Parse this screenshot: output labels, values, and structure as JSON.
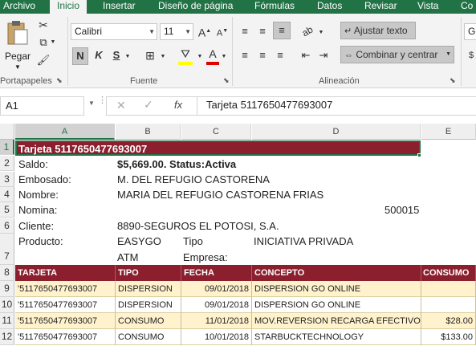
{
  "ribbon_tabs": [
    "Archivo",
    "Inicio",
    "Insertar",
    "Diseño de página",
    "Fórmulas",
    "Datos",
    "Revisar",
    "Vista",
    "Co"
  ],
  "clipboard": {
    "paste_label": "Pegar",
    "group_label": "Portapapeles"
  },
  "font": {
    "name": "Calibri",
    "size": "11",
    "bold": "N",
    "italic": "K",
    "underline": "S",
    "grow": "A",
    "shrink": "A",
    "color_a": "A",
    "group_label": "Fuente"
  },
  "alignment": {
    "wrap_text": "Ajustar texto",
    "merge_center": "Combinar y centrar",
    "group_label": "Alineación"
  },
  "number": {
    "format_partial": "Ge"
  },
  "formula_bar": {
    "cell_ref": "A1",
    "fx": "fx",
    "formula": "Tarjeta 5117650477693007"
  },
  "columns": [
    "A",
    "B",
    "C",
    "D",
    "E"
  ],
  "rows": [
    "1",
    "2",
    "3",
    "4",
    "5",
    "6",
    "7",
    "8",
    "9",
    "10",
    "11",
    "12"
  ],
  "sheet": {
    "title": "Tarjeta 5117650477693007",
    "saldo_label": "Saldo:",
    "saldo_value": "$5,669.00. Status:Activa",
    "embosado_label": "Embosado:",
    "embosado_value": "M. DEL REFUGIO CASTORENA",
    "nombre_label": "Nombre:",
    "nombre_value": "MARIA DEL REFUGIO CASTORENA FRIAS",
    "nomina_label": "Nomina:",
    "nomina_value": "500015",
    "cliente_label": "Cliente:",
    "cliente_value": "8890-SEGUROS EL POTOSI, S.A.",
    "producto_label": "Producto:",
    "producto_value": "EASYGO",
    "tipo_label": "Tipo",
    "tipo_value": "INICIATIVA PRIVADA",
    "atm_value": "ATM",
    "empresa_label": "Empresa:"
  },
  "table": {
    "headers": [
      "TARJETA",
      "TIPO",
      "FECHA",
      "CONCEPTO",
      "CONSUMO"
    ],
    "rows": [
      {
        "tarjeta": "'5117650477693007",
        "tipo": "DISPERSION",
        "fecha": "09/01/2018",
        "concepto": "DISPERSION GO ONLINE",
        "consumo": ""
      },
      {
        "tarjeta": "'5117650477693007",
        "tipo": "DISPERSION",
        "fecha": "09/01/2018",
        "concepto": "DISPERSION GO ONLINE",
        "consumo": ""
      },
      {
        "tarjeta": "'5117650477693007",
        "tipo": "CONSUMO",
        "fecha": "11/01/2018",
        "concepto": "MOV.REVERSION RECARGA EFECTIVO",
        "consumo": "$28.00"
      },
      {
        "tarjeta": "'5117650477693007",
        "tipo": "CONSUMO",
        "fecha": "10/01/2018",
        "concepto": "STARBUCKTECHNOLOGY",
        "consumo": "$133.00"
      }
    ]
  },
  "colors": {
    "excel_green": "#217346",
    "header_red": "#8b1f2e",
    "row_band": "#fff2cc"
  }
}
